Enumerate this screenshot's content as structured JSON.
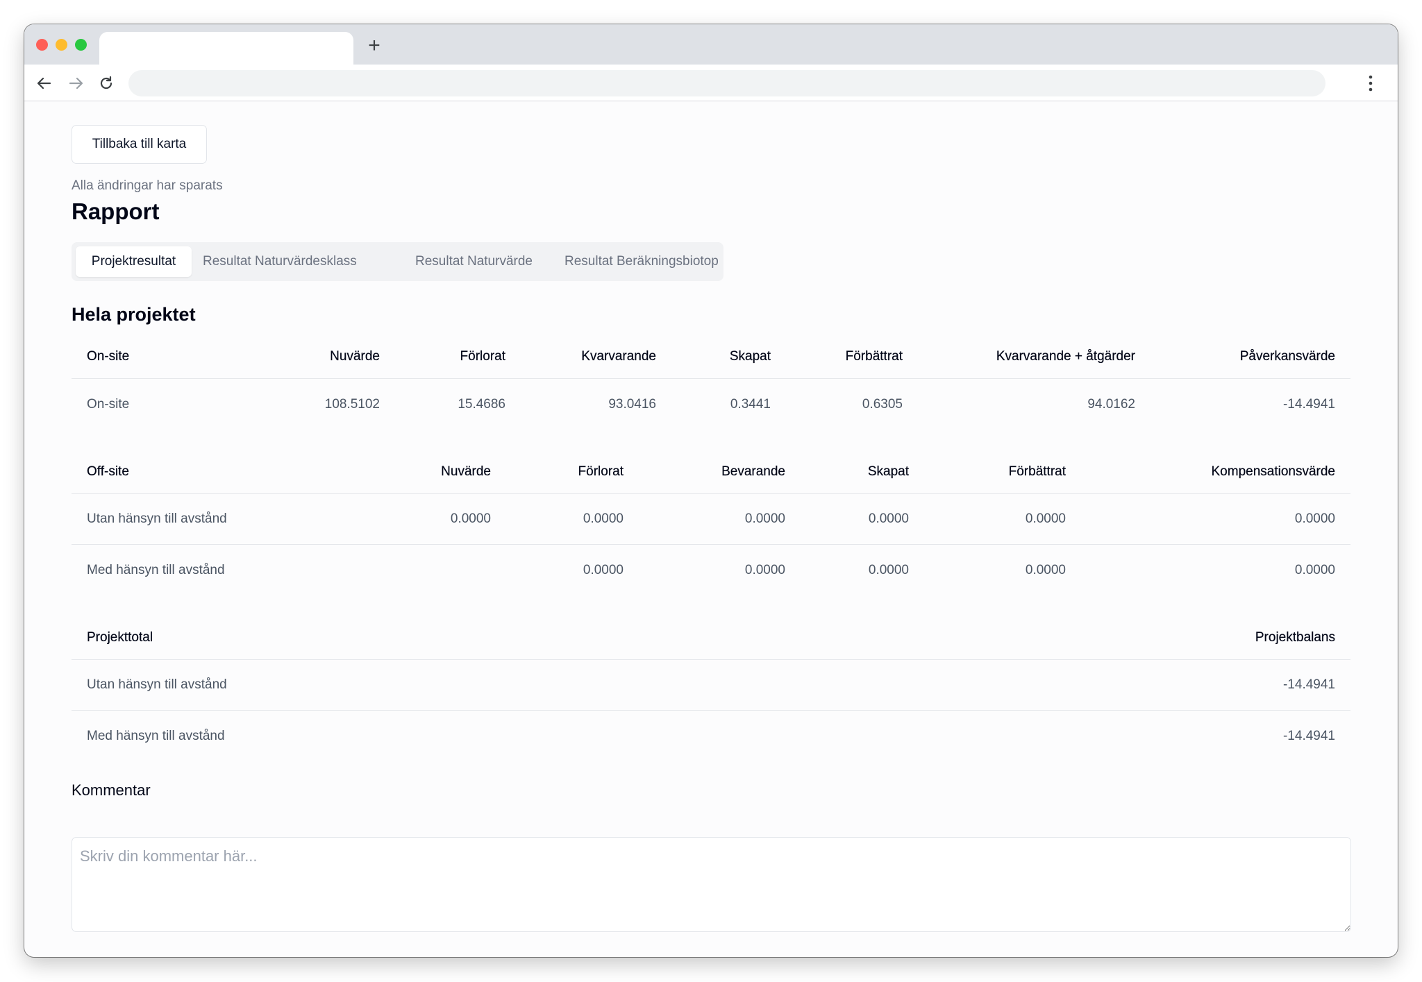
{
  "browser": {
    "new_tab_symbol": "+"
  },
  "page": {
    "back_button": "Tillbaka till karta",
    "saved_status": "Alla ändringar har sparats",
    "title": "Rapport",
    "tabs": [
      {
        "label": "Projektresultat",
        "active": true
      },
      {
        "label": "Resultat Naturvärdesklass",
        "active": false
      },
      {
        "label": "Resultat Naturvärde",
        "active": false
      },
      {
        "label": "Resultat Beräkningsbiotop",
        "active": false
      }
    ],
    "section_title": "Hela projektet",
    "onsite": {
      "headers": [
        "On-site",
        "Nuvärde",
        "Förlorat",
        "Kvarvarande",
        "Skapat",
        "Förbättrat",
        "Kvarvarande + åtgärder",
        "Påverkansvärde"
      ],
      "rows": [
        [
          "On-site",
          "108.5102",
          "15.4686",
          "93.0416",
          "0.3441",
          "0.6305",
          "94.0162",
          "-14.4941"
        ]
      ]
    },
    "offsite": {
      "headers": [
        "Off-site",
        "Nuvärde",
        "Förlorat",
        "Bevarande",
        "Skapat",
        "Förbättrat",
        "Kompensationsvärde"
      ],
      "rows": [
        [
          "Utan hänsyn till avstånd",
          "0.0000",
          "0.0000",
          "0.0000",
          "0.0000",
          "0.0000",
          "0.0000"
        ],
        [
          "Med hänsyn till avstånd",
          "",
          "0.0000",
          "0.0000",
          "0.0000",
          "0.0000",
          "0.0000"
        ]
      ]
    },
    "total": {
      "headers": [
        "Projekttotal",
        "Projektbalans"
      ],
      "rows": [
        [
          "Utan hänsyn till avstånd",
          "-14.4941"
        ],
        [
          "Med hänsyn till avstånd",
          "-14.4941"
        ]
      ]
    },
    "comment": {
      "label": "Kommentar",
      "placeholder": "Skriv din kommentar här...",
      "value": ""
    }
  }
}
